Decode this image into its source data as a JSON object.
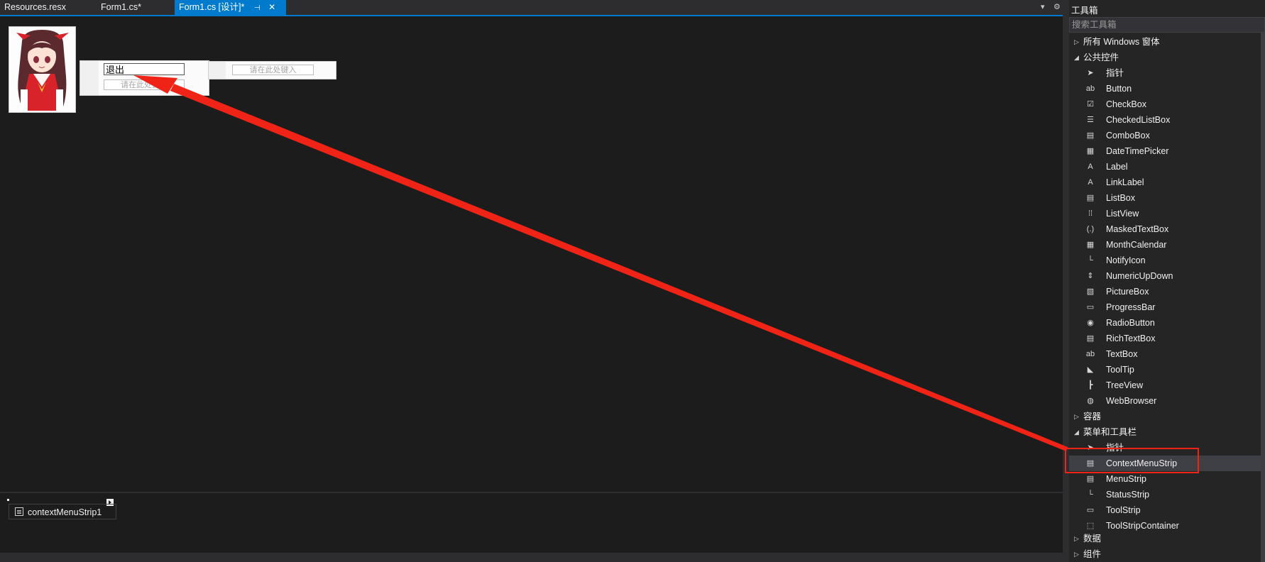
{
  "tabs": [
    {
      "label": "Resources.resx"
    },
    {
      "label": "Form1.cs*"
    },
    {
      "label": "Form1.cs [设计]*",
      "pin": "⊣",
      "close": "✕"
    }
  ],
  "tab_controls": {
    "dropdown": "▾",
    "settings": "⚙"
  },
  "designer": {
    "context_menu": {
      "item_exit": "退出",
      "type_here": "请在此处键入"
    },
    "submenu": {
      "type_here": "请在此处键入"
    }
  },
  "tray": {
    "component_label": "contextMenuStrip1"
  },
  "toolbox": {
    "title": "工具箱",
    "search_placeholder": "搜索工具箱",
    "sections": [
      {
        "label": "所有 Windows 窗体",
        "expanded": false
      },
      {
        "label": "公共控件",
        "expanded": true
      },
      {
        "label": "容器",
        "expanded": false
      },
      {
        "label": "菜单和工具栏",
        "expanded": true
      },
      {
        "label": "数据",
        "expanded": false
      },
      {
        "label": "组件",
        "expanded": false
      }
    ],
    "common_controls": [
      {
        "label": "指针",
        "icon": "pointer-icon"
      },
      {
        "label": "Button",
        "icon": "button-icon"
      },
      {
        "label": "CheckBox",
        "icon": "checkbox-icon"
      },
      {
        "label": "CheckedListBox",
        "icon": "checkedlistbox-icon"
      },
      {
        "label": "ComboBox",
        "icon": "combobox-icon"
      },
      {
        "label": "DateTimePicker",
        "icon": "datetimepicker-icon"
      },
      {
        "label": "Label",
        "icon": "label-icon"
      },
      {
        "label": "LinkLabel",
        "icon": "linklabel-icon"
      },
      {
        "label": "ListBox",
        "icon": "listbox-icon"
      },
      {
        "label": "ListView",
        "icon": "listview-icon"
      },
      {
        "label": "MaskedTextBox",
        "icon": "maskedtextbox-icon"
      },
      {
        "label": "MonthCalendar",
        "icon": "monthcalendar-icon"
      },
      {
        "label": "NotifyIcon",
        "icon": "notifyicon-icon"
      },
      {
        "label": "NumericUpDown",
        "icon": "numericupdown-icon"
      },
      {
        "label": "PictureBox",
        "icon": "picturebox-icon"
      },
      {
        "label": "ProgressBar",
        "icon": "progressbar-icon"
      },
      {
        "label": "RadioButton",
        "icon": "radiobutton-icon"
      },
      {
        "label": "RichTextBox",
        "icon": "richtextbox-icon"
      },
      {
        "label": "TextBox",
        "icon": "textbox-icon"
      },
      {
        "label": "ToolTip",
        "icon": "tooltip-icon"
      },
      {
        "label": "TreeView",
        "icon": "treeview-icon"
      },
      {
        "label": "WebBrowser",
        "icon": "webbrowser-icon"
      }
    ],
    "menus_toolbars": [
      {
        "label": "指针",
        "icon": "pointer-icon"
      },
      {
        "label": "ContextMenuStrip",
        "icon": "contextmenustrip-icon",
        "selected": true
      },
      {
        "label": "MenuStrip",
        "icon": "menustrip-icon"
      },
      {
        "label": "StatusStrip",
        "icon": "statusstrip-icon"
      },
      {
        "label": "ToolStrip",
        "icon": "toolstrip-icon"
      },
      {
        "label": "ToolStripContainer",
        "icon": "toolstripcontainer-icon"
      }
    ]
  },
  "colors": {
    "accent": "#007acc",
    "annotation": "#f02416",
    "background": "#1e1e1e"
  }
}
